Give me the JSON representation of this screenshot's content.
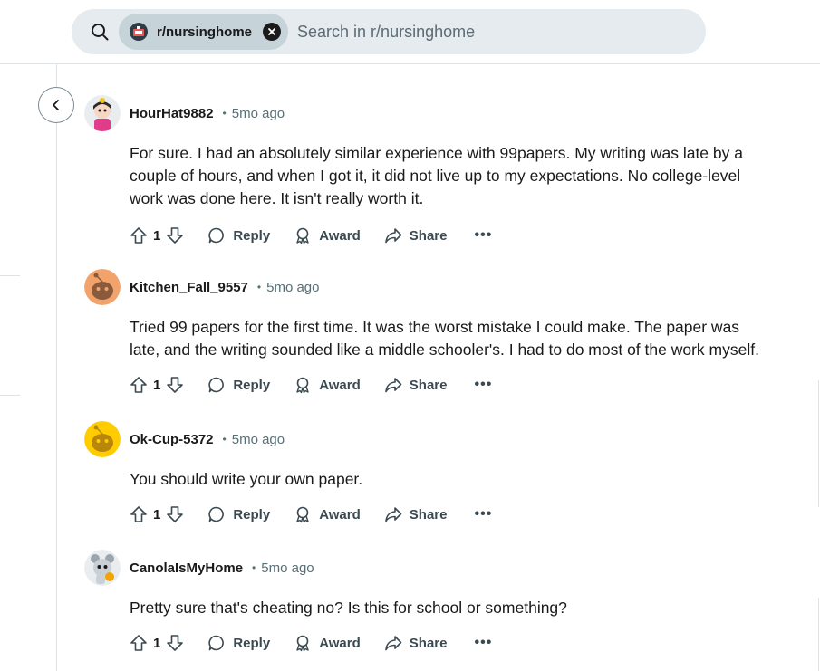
{
  "search": {
    "subreddit_chip": "r/nursinghome",
    "placeholder": "Search in r/nursinghome"
  },
  "comments": [
    {
      "username": "HourHat9882",
      "separator": "•",
      "time": "5mo ago",
      "body": "For sure. I had an absolutely similar experience with 99papers. My writing was late by a couple of hours, and when I got it, it did not live up to my expectations. No college-level work was done here. It isn't really worth it.",
      "votes": "1",
      "avatar_color": "#ffffff"
    },
    {
      "username": "Kitchen_Fall_9557",
      "separator": "•",
      "time": "5mo ago",
      "body": "Tried 99 papers for the first time. It was the worst mistake I could make. The paper was late, and the writing sounded like a middle schooler's. I had to do most of the work myself.",
      "votes": "1",
      "avatar_color": "#f2a36b"
    },
    {
      "username": "Ok-Cup-5372",
      "separator": "•",
      "time": "5mo ago",
      "body": "You should write your own paper.",
      "votes": "1",
      "avatar_color": "#ffcc00"
    },
    {
      "username": "CanolaIsMyHome",
      "separator": "•",
      "time": "5mo ago",
      "body": "Pretty sure that's cheating no? Is this for school or something?",
      "votes": "1",
      "avatar_color": "#ffffff"
    }
  ],
  "actions": {
    "reply": "Reply",
    "award": "Award",
    "share": "Share",
    "more": "•••"
  },
  "colors": {
    "search_bg": "#e5ebee",
    "chip_bg": "#c6d3d9",
    "meta_text": "#576f76",
    "action_text": "#3b4a52"
  }
}
